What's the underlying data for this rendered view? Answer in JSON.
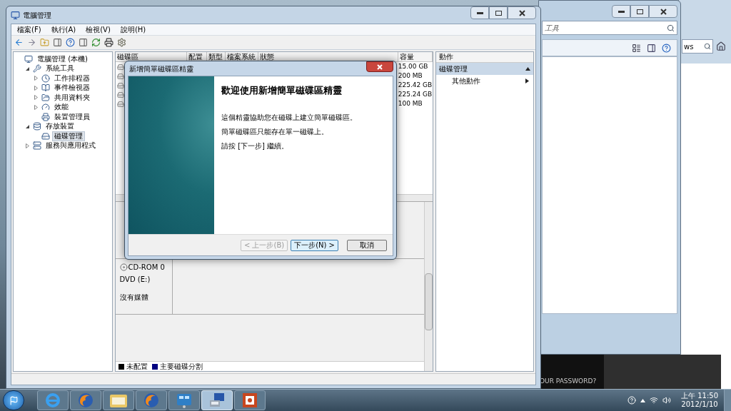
{
  "back_window": {
    "search_text": "工具"
  },
  "right_window": {
    "search_text": "ws"
  },
  "dark_panel": {
    "text": "OUR PASSWORD?"
  },
  "main_window": {
    "title": "電腦管理",
    "menu": [
      "檔案(F)",
      "執行(A)",
      "檢視(V)",
      "說明(H)"
    ],
    "tree": [
      {
        "label": "電腦管理 (本機)",
        "kind": "computer",
        "selected": false,
        "children": [
          {
            "label": "系統工具",
            "kind": "tools",
            "expanded": true,
            "selected": false,
            "children": [
              {
                "label": "工作排程器",
                "kind": "clock",
                "expanded": false,
                "selected": false
              },
              {
                "label": "事件檢視器",
                "kind": "event",
                "expanded": false,
                "selected": false
              },
              {
                "label": "共用資料夾",
                "kind": "folder",
                "expanded": false,
                "selected": false
              },
              {
                "label": "效能",
                "kind": "perf",
                "expanded": false,
                "selected": false
              },
              {
                "label": "裝置管理員",
                "kind": "device",
                "selected": false
              }
            ]
          },
          {
            "label": "存放裝置",
            "kind": "storage",
            "expanded": true,
            "selected": false,
            "children": [
              {
                "label": "磁碟管理",
                "kind": "disk",
                "selected": true
              }
            ]
          },
          {
            "label": "服務與應用程式",
            "kind": "services",
            "expanded": false,
            "selected": false
          }
        ]
      }
    ],
    "volume_table": {
      "columns": [
        "磁碟區",
        "配置",
        "類型",
        "檔案系統",
        "狀態",
        "容量"
      ],
      "rows": [
        {
          "capacity": "15.00 GB"
        },
        {
          "capacity": "200 MB"
        },
        {
          "capacity": "225.42 GB"
        },
        {
          "capacity": "225.24 GB"
        },
        {
          "capacity": "100 MB"
        }
      ]
    },
    "disks": [
      {
        "name": "CD-ROM 0",
        "type": "DVD (E:)",
        "status": "沒有媒體"
      }
    ],
    "legend": [
      {
        "label": "未配置",
        "color": "#000000"
      },
      {
        "label": "主要磁碟分割",
        "color": "#000080"
      }
    ],
    "actions": {
      "title": "動作",
      "section": "磁碟管理",
      "expanded": true,
      "items": [
        "其他動作"
      ]
    }
  },
  "dialog": {
    "title": "新增簡單磁碟區精靈",
    "heading": "歡迎使用新增簡單磁碟區精靈",
    "paragraphs": [
      "這個精靈協助您在磁碟上建立簡單磁碟區。",
      "簡單磁碟區只能存在單一磁碟上。",
      "請按 [下一步] 繼續。"
    ],
    "buttons": [
      {
        "label": "< 上一步(B)",
        "disabled": true,
        "default": false
      },
      {
        "label": "下一步(N) >",
        "disabled": false,
        "default": true
      },
      {
        "label": "取消",
        "disabled": false,
        "default": false
      }
    ]
  },
  "taskbar": {
    "apps": [
      {
        "kind": "ie",
        "active": false
      },
      {
        "kind": "firefox",
        "active": false
      },
      {
        "kind": "explorer",
        "active": false
      },
      {
        "kind": "firefox",
        "active": false
      },
      {
        "kind": "control",
        "active": false
      },
      {
        "kind": "computer",
        "active": true
      },
      {
        "kind": "slides",
        "active": false
      }
    ],
    "clock": {
      "time": "上午 11:50",
      "date": "2012/1/10"
    }
  }
}
